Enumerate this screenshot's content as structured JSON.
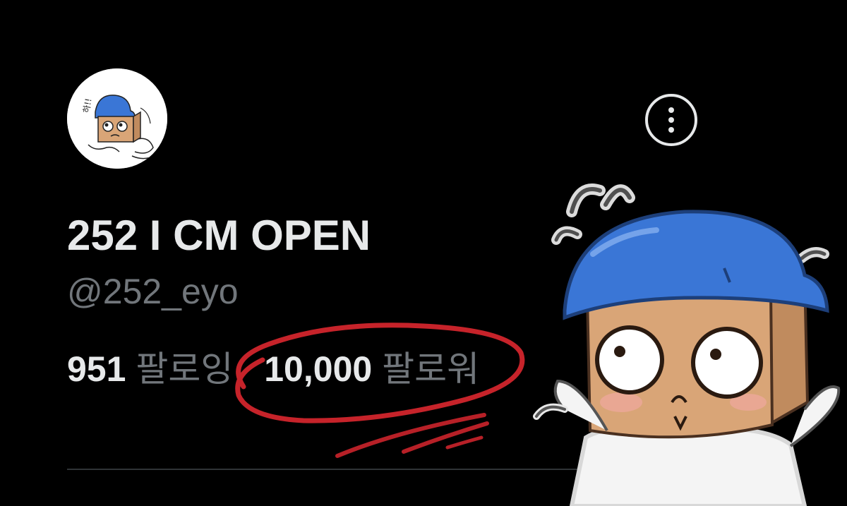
{
  "profile": {
    "display_name": "252 I CM OPEN",
    "handle": "@252_eyo",
    "following_count": "951",
    "following_label": "팔로잉",
    "followers_count": "10,000",
    "followers_label": "팔로워"
  },
  "avatar": {
    "icon": "cartoon-box-character-avatar",
    "doodle_text": "하!!"
  },
  "more_menu": {
    "icon": "more-vertical-icon"
  },
  "sticker": {
    "icon": "surprised-box-character-sticker"
  },
  "colors": {
    "background": "#000000",
    "primary_text": "#e7e9ea",
    "secondary_text": "#71767b",
    "divider": "#2f3336",
    "annotation_red": "#d7262e",
    "cap_blue": "#3a76d6",
    "box_tan": "#d9a577"
  }
}
